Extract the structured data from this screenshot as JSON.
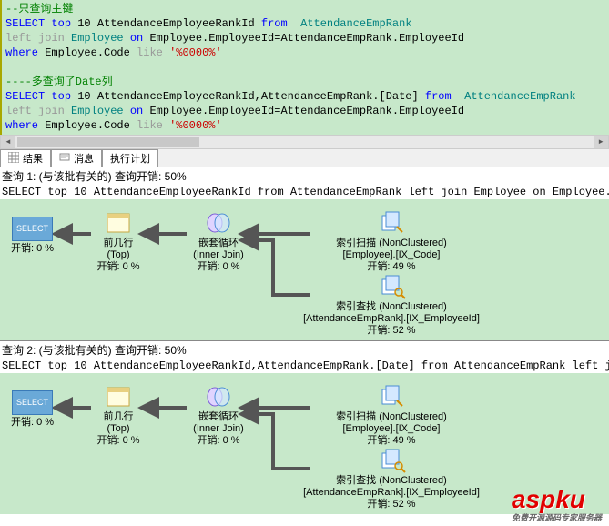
{
  "editor": {
    "comment1": "--只查询主键",
    "line1": {
      "select": "SELECT",
      "top": "top",
      "num": "10",
      "col": "AttendanceEmployeeRankId",
      "from": "from",
      "tbl": "AttendanceEmpRank"
    },
    "line2": {
      "left": "left join",
      "emp": "Employee",
      "on": "on",
      "j": "Employee.EmployeeId=AttendanceEmpRank.EmployeeId"
    },
    "line3": {
      "where": "where",
      "col": "Employee.Code",
      "like": "like",
      "str": "'%0000%'"
    },
    "comment2": "----多查询了Date列",
    "line4": {
      "select": "SELECT",
      "top": "top",
      "num": "10",
      "col": "AttendanceEmployeeRankId,AttendanceEmpRank.[Date]",
      "from": "from",
      "tbl": "AttendanceEmpRank"
    },
    "line5": {
      "left": "left join",
      "emp": "Employee",
      "on": "on",
      "j": "Employee.EmployeeId=AttendanceEmpRank.EmployeeId"
    },
    "line6": {
      "where": "where",
      "col": "Employee.Code",
      "like": "like",
      "str": "'%0000%'"
    }
  },
  "tabs": {
    "results": "结果",
    "messages": "消息",
    "plan": "执行计划"
  },
  "plan1": {
    "header": "查询 1: (与该批有关的) 查询开销: 50%",
    "sql": "SELECT top 10 AttendanceEmployeeRankId from AttendanceEmpRank left join Employee on Employee.E",
    "select": {
      "label": "SELECT",
      "cost": "开销: 0 %"
    },
    "top": {
      "label": "前几行",
      "sub": "(Top)",
      "cost": "开销: 0 %"
    },
    "join": {
      "label": "嵌套循环",
      "sub": "(Inner Join)",
      "cost": "开销: 0 %"
    },
    "scan": {
      "label": "索引扫描 (NonClustered)",
      "sub": "[Employee].[IX_Code]",
      "cost": "开销: 49 %"
    },
    "seek": {
      "label": "索引查找 (NonClustered)",
      "sub": "[AttendanceEmpRank].[IX_EmployeeId]",
      "cost": "开销: 52 %"
    }
  },
  "plan2": {
    "header": "查询 2: (与该批有关的) 查询开销: 50%",
    "sql": "SELECT top 10 AttendanceEmployeeRankId,AttendanceEmpRank.[Date] from AttendanceEmpRank left jo",
    "select": {
      "label": "SELECT",
      "cost": "开销: 0 %"
    },
    "top": {
      "label": "前几行",
      "sub": "(Top)",
      "cost": "开销: 0 %"
    },
    "join": {
      "label": "嵌套循环",
      "sub": "(Inner Join)",
      "cost": "开销: 0 %"
    },
    "scan": {
      "label": "索引扫描 (NonClustered)",
      "sub": "[Employee].[IX_Code]",
      "cost": "开销: 49 %"
    },
    "seek": {
      "label": "索引查找 (NonClustered)",
      "sub": "[AttendanceEmpRank].[IX_EmployeeId]",
      "cost": "开销: 52 %"
    }
  },
  "watermark": {
    "text": "aspku",
    "sub": "免费开源源码专家服务器"
  }
}
